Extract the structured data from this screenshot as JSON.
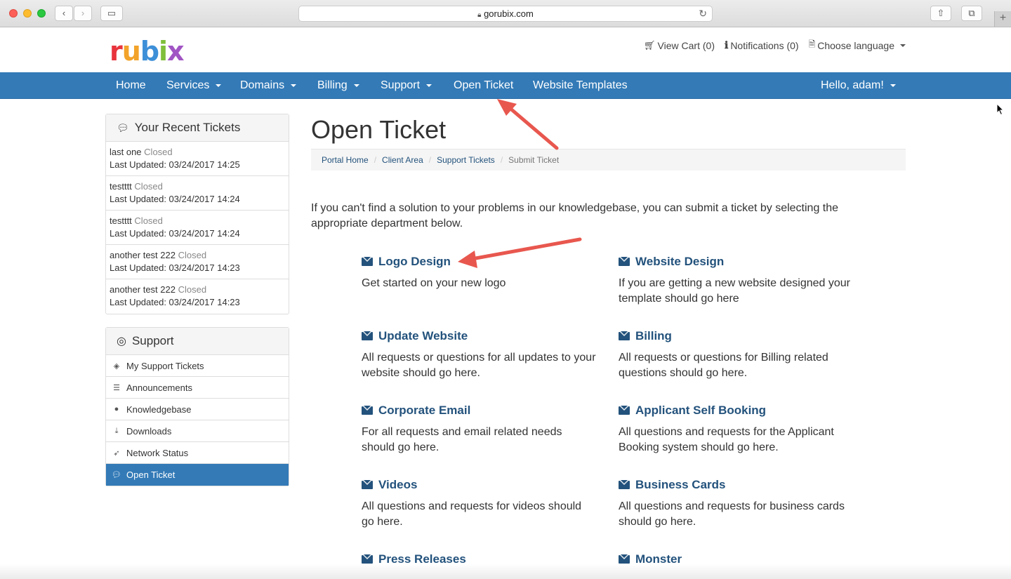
{
  "browser": {
    "url": "gorubix.com"
  },
  "brand": {
    "logo_letters": [
      "r",
      "u",
      "b",
      "i",
      "x"
    ]
  },
  "toplinks": {
    "cart": "View Cart (0)",
    "notifications": "Notifications (0)",
    "language": "Choose language"
  },
  "nav": {
    "home": "Home",
    "services": "Services",
    "domains": "Domains",
    "billing": "Billing",
    "support": "Support",
    "open_ticket": "Open Ticket",
    "website_templates": "Website Templates",
    "user": "Hello, adam!"
  },
  "recent_tickets": {
    "title": "Your Recent Tickets",
    "items": [
      {
        "name": "last one",
        "status": "Closed",
        "updated": "Last Updated: 03/24/2017 14:25"
      },
      {
        "name": "testttt",
        "status": "Closed",
        "updated": "Last Updated: 03/24/2017 14:24"
      },
      {
        "name": "testttt",
        "status": "Closed",
        "updated": "Last Updated: 03/24/2017 14:24"
      },
      {
        "name": "another test 222",
        "status": "Closed",
        "updated": "Last Updated: 03/24/2017 14:23"
      },
      {
        "name": "another test 222",
        "status": "Closed",
        "updated": "Last Updated: 03/24/2017 14:23"
      }
    ]
  },
  "support_panel": {
    "title": "Support",
    "items": [
      {
        "label": "My Support Tickets",
        "icon": "ticket-icon"
      },
      {
        "label": "Announcements",
        "icon": "list-icon"
      },
      {
        "label": "Knowledgebase",
        "icon": "info-icon"
      },
      {
        "label": "Downloads",
        "icon": "download-icon"
      },
      {
        "label": "Network Status",
        "icon": "rocket-icon"
      },
      {
        "label": "Open Ticket",
        "icon": "comments-icon"
      }
    ]
  },
  "main": {
    "title": "Open Ticket",
    "breadcrumb": [
      "Portal Home",
      "Client Area",
      "Support Tickets",
      "Submit Ticket"
    ],
    "intro": "If you can't find a solution to your problems in our knowledgebase, you can submit a ticket by selecting the appropriate department below.",
    "departments": [
      {
        "name": "Logo Design",
        "desc": "Get started on your new logo"
      },
      {
        "name": "Website Design",
        "desc": "If you are getting a new website designed your template should go here"
      },
      {
        "name": "Update Website",
        "desc": "All requests or questions for all updates to your website should go here."
      },
      {
        "name": "Billing",
        "desc": "All requests or questions for Billing related questions should go here."
      },
      {
        "name": "Corporate Email",
        "desc": "For all requests and email related needs should go here."
      },
      {
        "name": "Applicant Self Booking",
        "desc": "All questions and requests for the Applicant Booking system should go here."
      },
      {
        "name": "Videos",
        "desc": "All questions and requests for videos should go here."
      },
      {
        "name": "Business Cards",
        "desc": "All questions and requests for business cards should go here."
      },
      {
        "name": "Press Releases",
        "desc": ""
      },
      {
        "name": "Monster",
        "desc": ""
      }
    ]
  },
  "colors": {
    "nav_blue": "#337ab7",
    "link_blue": "#23527c",
    "annotation_red": "#e8574e"
  }
}
